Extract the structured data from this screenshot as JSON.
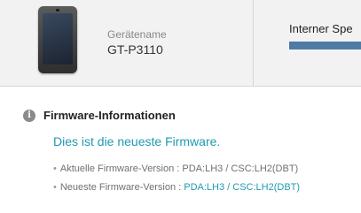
{
  "device": {
    "name_label": "Gerätename",
    "model": "GT-P3110"
  },
  "storage": {
    "label": "Interner Spe"
  },
  "firmware": {
    "section_title": "Firmware-Informationen",
    "status": "Dies ist die neueste Firmware.",
    "current_label": "Aktuelle Firmware-Version : ",
    "current_value": "PDA:LH3 / CSC:LH2(DBT)",
    "latest_label": "Neueste Firmware-Version : ",
    "latest_value": "PDA:LH3 / CSC:LH2(DBT)"
  },
  "icons": {
    "info": "info-icon",
    "device": "tablet-icon"
  },
  "colors": {
    "accent": "#1f9bb2",
    "storage_bar": "#4f7aa4",
    "panel_bg": "#f2f2f2"
  }
}
